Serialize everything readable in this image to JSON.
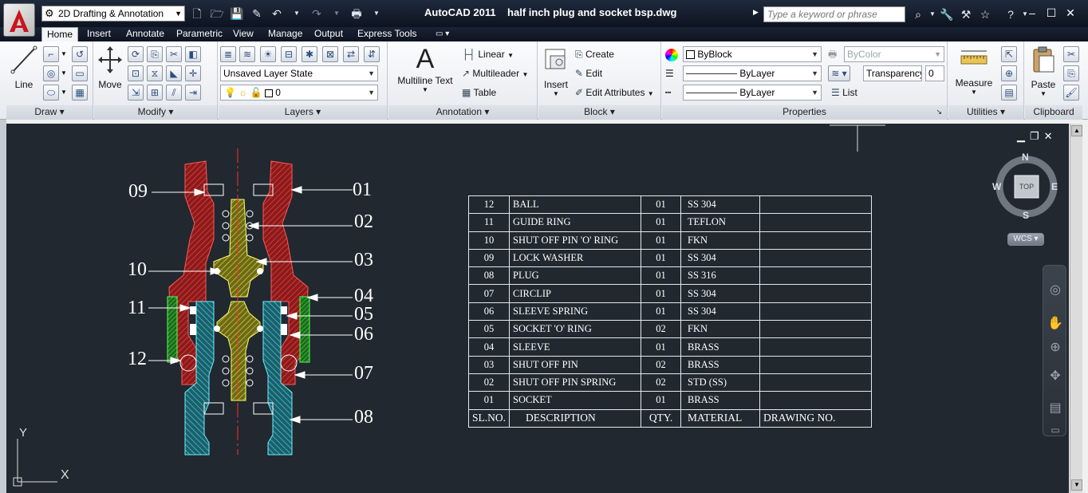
{
  "titlebar": {
    "workspace": "2D Drafting & Annotation",
    "app_name": "AutoCAD 2011",
    "file_name": "half inch plug and socket bsp.dwg",
    "search_placeholder": "Type a keyword or phrase"
  },
  "tabs": [
    "Home",
    "Insert",
    "Annotate",
    "Parametric",
    "View",
    "Manage",
    "Output",
    "Express Tools"
  ],
  "active_tab": "Home",
  "ribbon": {
    "draw": {
      "title": "Draw",
      "line": "Line"
    },
    "modify": {
      "title": "Modify",
      "move": "Move"
    },
    "layers": {
      "title": "Layers",
      "layer_state": "Unsaved Layer State",
      "current_layer": "0"
    },
    "annotation": {
      "title": "Annotation",
      "multiline_text": "Multiline Text",
      "linear": "Linear",
      "multileader": "Multileader",
      "table": "Table"
    },
    "block": {
      "title": "Block",
      "insert": "Insert",
      "create": "Create",
      "edit": "Edit",
      "edit_attributes": "Edit Attributes"
    },
    "properties": {
      "title": "Properties",
      "color": "ByBlock",
      "linetype": "ByLayer",
      "lineweight": "ByLayer",
      "plot_style": "ByColor",
      "transparency_label": "Transparency",
      "transparency_value": "0",
      "list": "List"
    },
    "utilities": {
      "title": "Utilities",
      "measure": "Measure"
    },
    "clipboard": {
      "title": "Clipboard",
      "paste": "Paste"
    }
  },
  "viewcube": {
    "north": "N",
    "south": "S",
    "east": "E",
    "west": "W",
    "face": "TOP",
    "wcs": "WCS"
  },
  "ucs": {
    "x": "X",
    "y": "Y"
  },
  "balloons": {
    "b01": "01",
    "b02": "02",
    "b03": "03",
    "b04": "04",
    "b05": "05",
    "b06": "06",
    "b07": "07",
    "b08": "08",
    "b09": "09",
    "b10": "10",
    "b11": "11",
    "b12": "12"
  },
  "parts_table": {
    "rows": [
      [
        "12",
        "BALL",
        "01",
        "SS 304",
        ""
      ],
      [
        "11",
        "GUIDE RING",
        "01",
        "TEFLON",
        ""
      ],
      [
        "10",
        "SHUT OFF PIN 'O' RING",
        "01",
        "FKN",
        ""
      ],
      [
        "09",
        "LOCK WASHER",
        "01",
        "SS 304",
        ""
      ],
      [
        "08",
        "PLUG",
        "01",
        "SS 316",
        ""
      ],
      [
        "07",
        "CIRCLIP",
        "01",
        "SS 304",
        ""
      ],
      [
        "06",
        "SLEEVE SPRING",
        "01",
        "SS 304",
        ""
      ],
      [
        "05",
        "SOCKET 'O' RING",
        "02",
        "FKN",
        ""
      ],
      [
        "04",
        "SLEEVE",
        "01",
        "BRASS",
        ""
      ],
      [
        "03",
        "SHUT OFF PIN",
        "02",
        "BRASS",
        ""
      ],
      [
        "02",
        "SHUT OFF PIN SPRING",
        "02",
        "STD (SS)",
        ""
      ],
      [
        "01",
        "SOCKET",
        "01",
        "BRASS",
        ""
      ]
    ],
    "header": [
      "SL.NO.",
      "DESCRIPTION",
      "QTY.",
      "MATERIAL",
      "DRAWING NO."
    ]
  }
}
